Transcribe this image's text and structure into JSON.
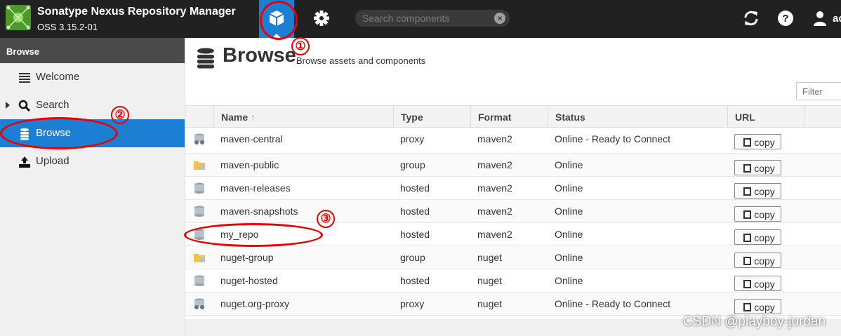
{
  "app": {
    "title": "Sonatype Nexus Repository Manager",
    "version": "OSS 3.15.2-01",
    "brand_color": "#4c9a2a",
    "accent": "#1c7fd3"
  },
  "header": {
    "search_placeholder": "Search components",
    "search_value": "",
    "user_label": "ac",
    "icons": [
      "cube-icon",
      "gear-icon",
      "refresh-icon",
      "help-icon",
      "user-icon"
    ]
  },
  "annotations": [
    "①",
    "②",
    "③"
  ],
  "sidebar": {
    "header": "Browse",
    "items": [
      {
        "label": "Welcome",
        "icon": "welcome-icon"
      },
      {
        "label": "Search",
        "icon": "search-icon"
      },
      {
        "label": "Browse",
        "icon": "database-icon",
        "active": true
      },
      {
        "label": "Upload",
        "icon": "upload-icon"
      }
    ]
  },
  "page": {
    "title": "Browse",
    "subtitle": "Browse assets and components",
    "filter_placeholder": "Filter"
  },
  "table": {
    "columns": [
      "Name",
      "Type",
      "Format",
      "Status",
      "URL"
    ],
    "sort_indicator": "↑",
    "copy_label": "copy",
    "rows": [
      {
        "name": "maven-central",
        "type": "proxy",
        "format": "maven2",
        "status": "Online - Ready to Connect",
        "icon": "proxy-repo-icon"
      },
      {
        "name": "maven-public",
        "type": "group",
        "format": "maven2",
        "status": "Online",
        "icon": "group-repo-icon"
      },
      {
        "name": "maven-releases",
        "type": "hosted",
        "format": "maven2",
        "status": "Online",
        "icon": "hosted-repo-icon"
      },
      {
        "name": "maven-snapshots",
        "type": "hosted",
        "format": "maven2",
        "status": "Online",
        "icon": "hosted-repo-icon"
      },
      {
        "name": "my_repo",
        "type": "hosted",
        "format": "maven2",
        "status": "Online",
        "icon": "hosted-repo-icon"
      },
      {
        "name": "nuget-group",
        "type": "group",
        "format": "nuget",
        "status": "Online",
        "icon": "group-repo-icon"
      },
      {
        "name": "nuget-hosted",
        "type": "hosted",
        "format": "nuget",
        "status": "Online",
        "icon": "hosted-repo-icon"
      },
      {
        "name": "nuget.org-proxy",
        "type": "proxy",
        "format": "nuget",
        "status": "Online - Ready to Connect",
        "icon": "proxy-repo-icon"
      }
    ]
  },
  "watermark": "CSDN @playboy-jordan"
}
